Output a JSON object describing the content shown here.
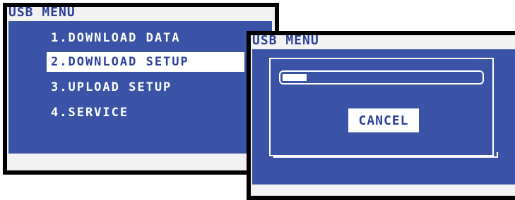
{
  "colors": {
    "screen_panel": "#3b53a6",
    "title_text": "#2b3f9a",
    "highlight_bg": "#ffffff",
    "bezel": "#000000"
  },
  "screen1": {
    "title": "USB MENU",
    "menu": [
      {
        "label": "1.DOWNLOAD DATA",
        "selected": false
      },
      {
        "label": "2.DOWNLOAD SETUP",
        "selected": true
      },
      {
        "label": "3.UPLOAD SETUP",
        "selected": false
      },
      {
        "label": "4.SERVICE",
        "selected": false
      }
    ]
  },
  "screen2": {
    "title": "USB MENU",
    "progress_fraction": 0.12,
    "cancel_label": "CANCEL"
  }
}
